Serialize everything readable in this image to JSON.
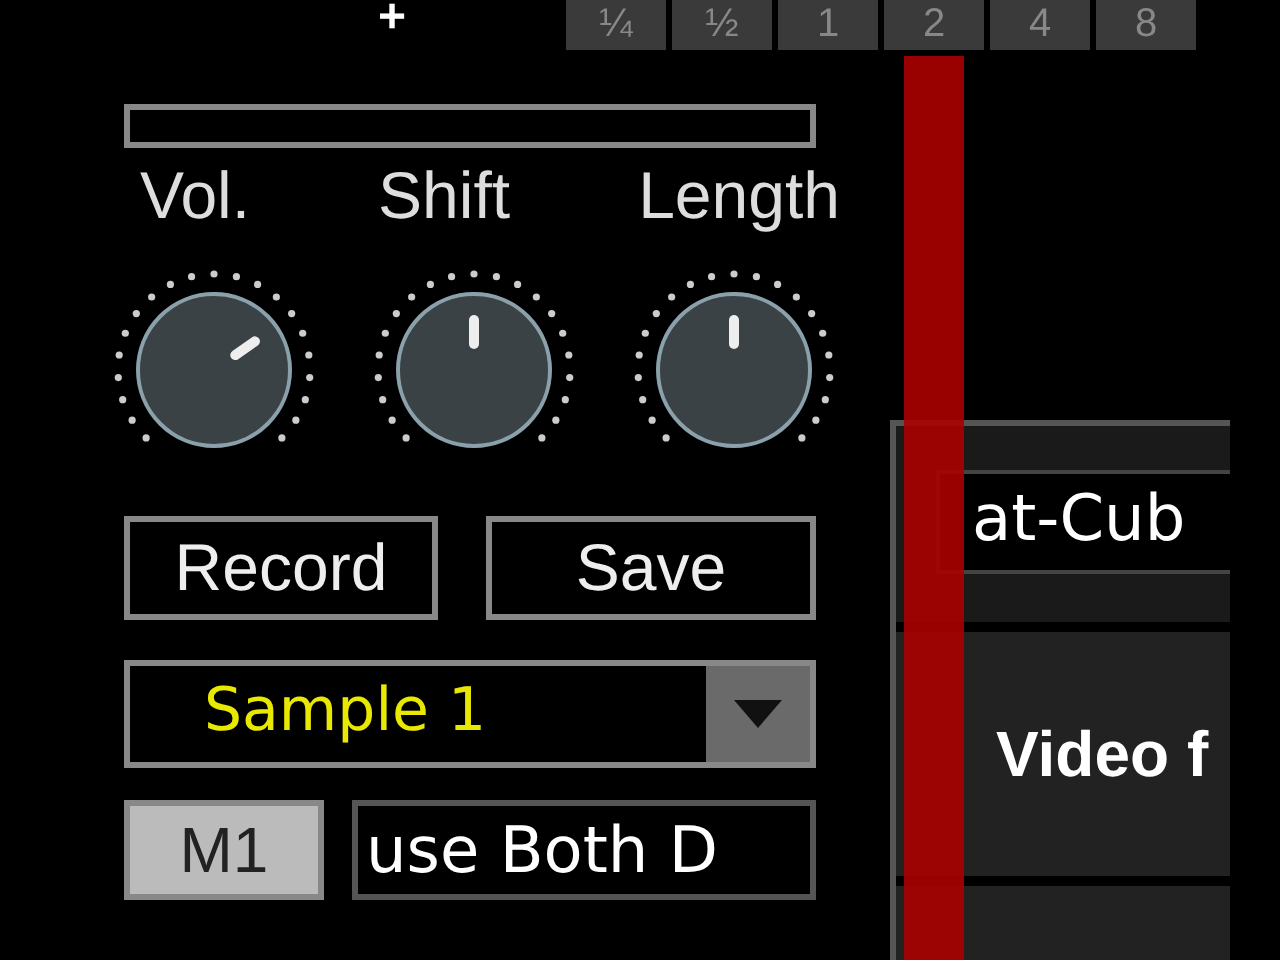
{
  "add_button": "+",
  "zoom_tabs": [
    {
      "label": "¼",
      "selected": false
    },
    {
      "label": "½",
      "selected": false
    },
    {
      "label": "1",
      "selected": false
    },
    {
      "label": "2",
      "selected": false
    },
    {
      "label": "4",
      "selected": false
    },
    {
      "label": "8",
      "selected": false
    }
  ],
  "knobs": [
    {
      "label": "Vol."
    },
    {
      "label": "Shift"
    },
    {
      "label": "Length"
    }
  ],
  "buttons": [
    "Record",
    "Save"
  ],
  "sample_select": {
    "value": "Sample 1"
  },
  "macros": [
    {
      "button": "M1",
      "text": "use Both D"
    }
  ],
  "clip_panel": {
    "name_field": "at-Cub",
    "video_label": "Video f"
  }
}
